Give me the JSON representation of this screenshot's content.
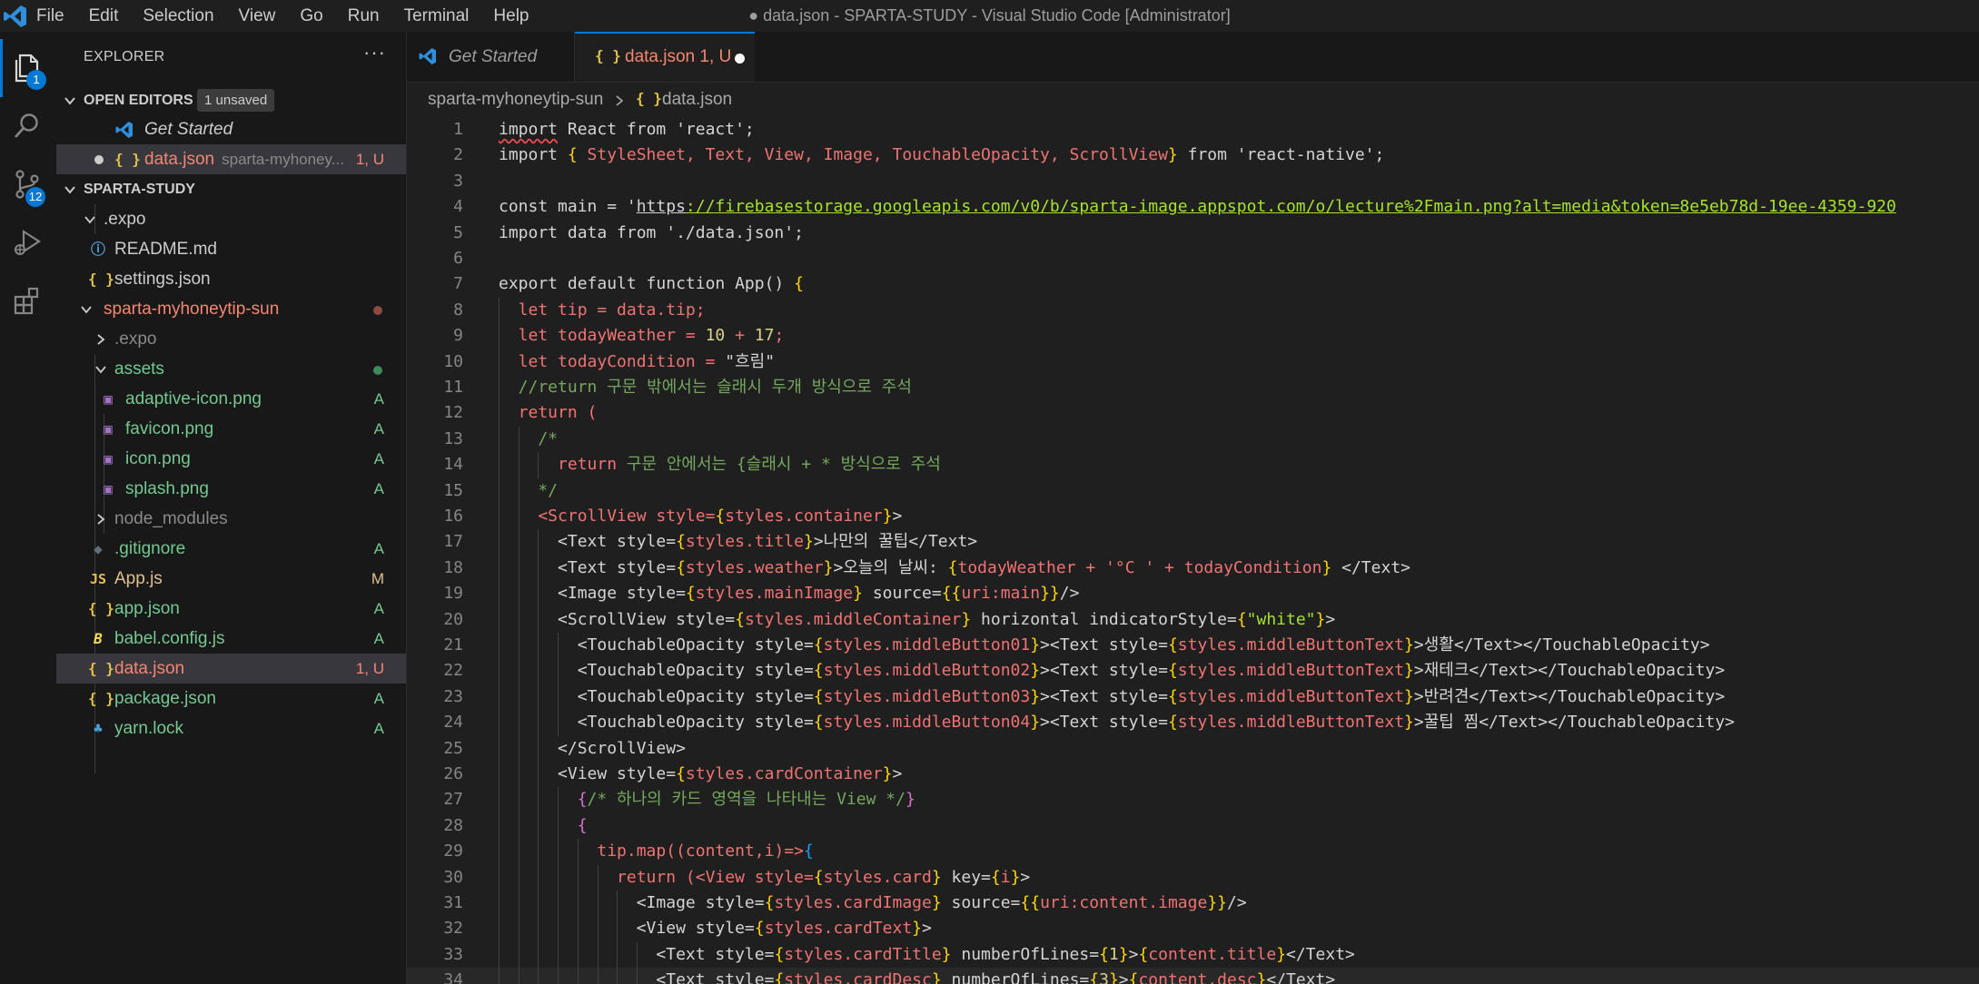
{
  "window": {
    "title": "● data.json - SPARTA-STUDY - Visual Studio Code [Administrator]",
    "menu": [
      "File",
      "Edit",
      "Selection",
      "View",
      "Go",
      "Run",
      "Terminal",
      "Help"
    ]
  },
  "activity_bar": {
    "explorer_badge": "1",
    "source_control_badge": "12",
    "accent_color": "#0078d4"
  },
  "sidebar": {
    "title": "EXPLORER",
    "more_label": "···",
    "open_editors": {
      "label": "OPEN EDITORS",
      "badge": "1 unsaved",
      "items": [
        {
          "name": "Get Started",
          "icon": "vscode-icon"
        },
        {
          "name": "data.json",
          "description": "sparta-myhoney...",
          "status": "1, U",
          "icon": "json-icon"
        }
      ]
    },
    "workspace": {
      "label": "SPARTA-STUDY",
      "items": [
        {
          "name": ".expo",
          "type": "folder-open"
        },
        {
          "name": "README.md",
          "type": "info"
        },
        {
          "name": "settings.json",
          "type": "json"
        },
        {
          "name": "sparta-myhoneytip-sun",
          "type": "folder-open"
        },
        {
          "name": ".expo",
          "type": "folder-closed"
        },
        {
          "name": "assets",
          "type": "folder-open"
        },
        {
          "name": "adaptive-icon.png",
          "type": "image",
          "status": "A"
        },
        {
          "name": "favicon.png",
          "type": "image",
          "status": "A"
        },
        {
          "name": "icon.png",
          "type": "image",
          "status": "A"
        },
        {
          "name": "splash.png",
          "type": "image",
          "status": "A"
        },
        {
          "name": "node_modules",
          "type": "folder-closed"
        },
        {
          "name": ".gitignore",
          "type": "git",
          "status": "A"
        },
        {
          "name": "App.js",
          "type": "js",
          "status": "M"
        },
        {
          "name": "app.json",
          "type": "json",
          "status": "A"
        },
        {
          "name": "babel.config.js",
          "type": "babel",
          "status": "A"
        },
        {
          "name": "data.json",
          "type": "json",
          "status": "1, U"
        },
        {
          "name": "package.json",
          "type": "json",
          "status": "A"
        },
        {
          "name": "yarn.lock",
          "type": "yarn",
          "status": "A"
        }
      ]
    }
  },
  "tabs": [
    {
      "label": "Get Started",
      "icon": "vscode-icon"
    },
    {
      "label": "data.json 1, U",
      "icon": "json-icon",
      "active": true,
      "dirty": true
    }
  ],
  "breadcrumbs": [
    "sparta-myhoneytip-sun",
    "data.json"
  ],
  "json_icon_text": "{ }",
  "code": {
    "colors": {
      "keyword": "#f07373",
      "string": "#a6e22e",
      "comment": "#74a85e",
      "number": "#d8d28a",
      "bracket1": "#ffd700",
      "bracket2": "#da70d6",
      "bracket3": "#179fff"
    },
    "lines": [
      [
        [
          "import",
          "err"
        ],
        [
          " React from 'react';",
          "def"
        ]
      ],
      [
        [
          "import ",
          "def"
        ],
        [
          "{",
          "br1"
        ],
        [
          " StyleSheet, Text, View, Image, TouchableOpacity, ScrollView",
          "kw"
        ],
        [
          "}",
          "br1"
        ],
        [
          " from 'react-native';",
          "def"
        ]
      ],
      [],
      [
        [
          "const main = '",
          "def"
        ],
        [
          "https",
          "def"
        ],
        [
          "://firebasestorage.googleapis.com/v0/b/sparta-image.appspot.com/o/lecture%2Fmain.png?alt=media&token=8e5eb78d-19ee-4359-920",
          "url"
        ]
      ],
      [
        [
          "import data from './data.json';",
          "def"
        ]
      ],
      [],
      [
        [
          "export default function App() ",
          "def"
        ],
        [
          "{",
          "br1"
        ]
      ],
      [
        [
          "  let tip = data.tip;",
          "kw"
        ]
      ],
      [
        [
          "  let todayWeather = ",
          "kw"
        ],
        [
          "10",
          "num"
        ],
        [
          " + ",
          "kw"
        ],
        [
          "17",
          "num"
        ],
        [
          ";",
          "kw"
        ]
      ],
      [
        [
          "  let todayCondition = ",
          "kw"
        ],
        [
          "\"흐림\"",
          "def"
        ]
      ],
      [
        [
          "  //return 구문 밖에서는 슬래시 두개 방식으로 주석",
          "cmt"
        ]
      ],
      [
        [
          "  return (",
          "kw"
        ]
      ],
      [
        [
          "    /*",
          "cmt"
        ]
      ],
      [
        [
          "      return ",
          "kw"
        ],
        [
          "구문 안에서는 {슬래시 + * 방식으로 주석",
          "cmt"
        ]
      ],
      [
        [
          "    */",
          "cmt"
        ]
      ],
      [
        [
          "    <ScrollView style=",
          "kw"
        ],
        [
          "{",
          "br1"
        ],
        [
          "styles.container",
          "kw"
        ],
        [
          "}",
          "br1"
        ],
        [
          ">",
          "def"
        ]
      ],
      [
        [
          "      <Text style=",
          "def"
        ],
        [
          "{",
          "br1"
        ],
        [
          "styles.title",
          "kw"
        ],
        [
          "}",
          "br1"
        ],
        [
          ">나만의 꿀팁</Text>",
          "def"
        ]
      ],
      [
        [
          "      <Text style=",
          "def"
        ],
        [
          "{",
          "br1"
        ],
        [
          "styles.weather",
          "kw"
        ],
        [
          "}",
          "br1"
        ],
        [
          ">오늘의 날씨: ",
          "def"
        ],
        [
          "{",
          "br1"
        ],
        [
          "todayWeather + '°C ' + todayCondition",
          "kw"
        ],
        [
          "}",
          "br1"
        ],
        [
          " </Text>",
          "def"
        ]
      ],
      [
        [
          "      <Image style=",
          "def"
        ],
        [
          "{",
          "br1"
        ],
        [
          "styles.mainImage",
          "kw"
        ],
        [
          "}",
          "br1"
        ],
        [
          " source=",
          "def"
        ],
        [
          "{{",
          "br1"
        ],
        [
          "uri:main",
          "kw"
        ],
        [
          "}}",
          "br1"
        ],
        [
          "/>",
          "def"
        ]
      ],
      [
        [
          "      <ScrollView style=",
          "def"
        ],
        [
          "{",
          "br1"
        ],
        [
          "styles.middleContainer",
          "kw"
        ],
        [
          "}",
          "br1"
        ],
        [
          " horizontal indicatorStyle=",
          "def"
        ],
        [
          "{",
          "br1"
        ],
        [
          "\"white\"",
          "str"
        ],
        [
          "}",
          "br1"
        ],
        [
          ">",
          "def"
        ]
      ],
      [
        [
          "        <TouchableOpacity style=",
          "def"
        ],
        [
          "{",
          "br1"
        ],
        [
          "styles.middleButton01",
          "kw"
        ],
        [
          "}",
          "br1"
        ],
        [
          "><Text style=",
          "def"
        ],
        [
          "{",
          "br1"
        ],
        [
          "styles.middleButtonText",
          "kw"
        ],
        [
          "}",
          "br1"
        ],
        [
          ">생활</Text></TouchableOpacity>",
          "def"
        ]
      ],
      [
        [
          "        <TouchableOpacity style=",
          "def"
        ],
        [
          "{",
          "br1"
        ],
        [
          "styles.middleButton02",
          "kw"
        ],
        [
          "}",
          "br1"
        ],
        [
          "><Text style=",
          "def"
        ],
        [
          "{",
          "br1"
        ],
        [
          "styles.middleButtonText",
          "kw"
        ],
        [
          "}",
          "br1"
        ],
        [
          ">재테크</Text></TouchableOpacity>",
          "def"
        ]
      ],
      [
        [
          "        <TouchableOpacity style=",
          "def"
        ],
        [
          "{",
          "br1"
        ],
        [
          "styles.middleButton03",
          "kw"
        ],
        [
          "}",
          "br1"
        ],
        [
          "><Text style=",
          "def"
        ],
        [
          "{",
          "br1"
        ],
        [
          "styles.middleButtonText",
          "kw"
        ],
        [
          "}",
          "br1"
        ],
        [
          ">반려견</Text></TouchableOpacity>",
          "def"
        ]
      ],
      [
        [
          "        <TouchableOpacity style=",
          "def"
        ],
        [
          "{",
          "br1"
        ],
        [
          "styles.middleButton04",
          "kw"
        ],
        [
          "}",
          "br1"
        ],
        [
          "><Text style=",
          "def"
        ],
        [
          "{",
          "br1"
        ],
        [
          "styles.middleButtonText",
          "kw"
        ],
        [
          "}",
          "br1"
        ],
        [
          ">꿀팁 찜</Text></TouchableOpacity>",
          "def"
        ]
      ],
      [
        [
          "      </ScrollView>",
          "def"
        ]
      ],
      [
        [
          "      <View style=",
          "def"
        ],
        [
          "{",
          "br1"
        ],
        [
          "styles.cardContainer",
          "kw"
        ],
        [
          "}",
          "br1"
        ],
        [
          ">",
          "def"
        ]
      ],
      [
        [
          "        ",
          "def"
        ],
        [
          "{",
          "br2"
        ],
        [
          "/* 하나의 카드 영역을 나타내는 View */",
          "cmt"
        ],
        [
          "}",
          "br2"
        ]
      ],
      [
        [
          "        ",
          "def"
        ],
        [
          "{",
          "br2"
        ]
      ],
      [
        [
          "          tip.map((content,i)=>",
          "kw"
        ],
        [
          "{",
          "br3"
        ]
      ],
      [
        [
          "            return (<View style=",
          "kw"
        ],
        [
          "{",
          "br1"
        ],
        [
          "styles.card",
          "kw"
        ],
        [
          "}",
          "br1"
        ],
        [
          " key=",
          "def"
        ],
        [
          "{",
          "br1"
        ],
        [
          "i",
          "kw"
        ],
        [
          "}",
          "br1"
        ],
        [
          ">",
          "def"
        ]
      ],
      [
        [
          "              <Image style=",
          "def"
        ],
        [
          "{",
          "br1"
        ],
        [
          "styles.cardImage",
          "kw"
        ],
        [
          "}",
          "br1"
        ],
        [
          " source=",
          "def"
        ],
        [
          "{{",
          "br1"
        ],
        [
          "uri:content.image",
          "kw"
        ],
        [
          "}}",
          "br1"
        ],
        [
          "/>",
          "def"
        ]
      ],
      [
        [
          "              <View style=",
          "def"
        ],
        [
          "{",
          "br1"
        ],
        [
          "styles.cardText",
          "kw"
        ],
        [
          "}",
          "br1"
        ],
        [
          ">",
          "def"
        ]
      ],
      [
        [
          "                <Text style=",
          "def"
        ],
        [
          "{",
          "br1"
        ],
        [
          "styles.cardTitle",
          "kw"
        ],
        [
          "}",
          "br1"
        ],
        [
          " numberOfLines=",
          "def"
        ],
        [
          "{",
          "br1"
        ],
        [
          "1",
          "num"
        ],
        [
          "}",
          "br1"
        ],
        [
          ">",
          "def"
        ],
        [
          "{",
          "br1"
        ],
        [
          "content.title",
          "kw"
        ],
        [
          "}",
          "br1"
        ],
        [
          "</Text>",
          "def"
        ]
      ],
      [
        [
          "                <Text style=",
          "def"
        ],
        [
          "{",
          "br1"
        ],
        [
          "styles.cardDesc",
          "kw"
        ],
        [
          "}",
          "br1"
        ],
        [
          " numberOfLines=",
          "def"
        ],
        [
          "{",
          "br1"
        ],
        [
          "3",
          "num"
        ],
        [
          "}",
          "br1"
        ],
        [
          ">",
          "def"
        ],
        [
          "{",
          "br1"
        ],
        [
          "content.desc",
          "kw"
        ],
        [
          "}",
          "br1"
        ],
        [
          "</Text>",
          "def"
        ]
      ]
    ]
  }
}
